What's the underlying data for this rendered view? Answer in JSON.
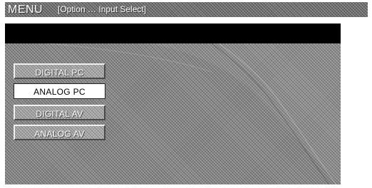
{
  "title_bar": {
    "menu_label": "MENU",
    "breadcrumb": "[Option … Input Select]"
  },
  "inputs": {
    "selected_index": 1,
    "items": [
      {
        "label": "DIGITAL PC"
      },
      {
        "label": "ANALOG PC"
      },
      {
        "label": "DIGITAL AV"
      },
      {
        "label": "ANALOG AV"
      }
    ]
  }
}
